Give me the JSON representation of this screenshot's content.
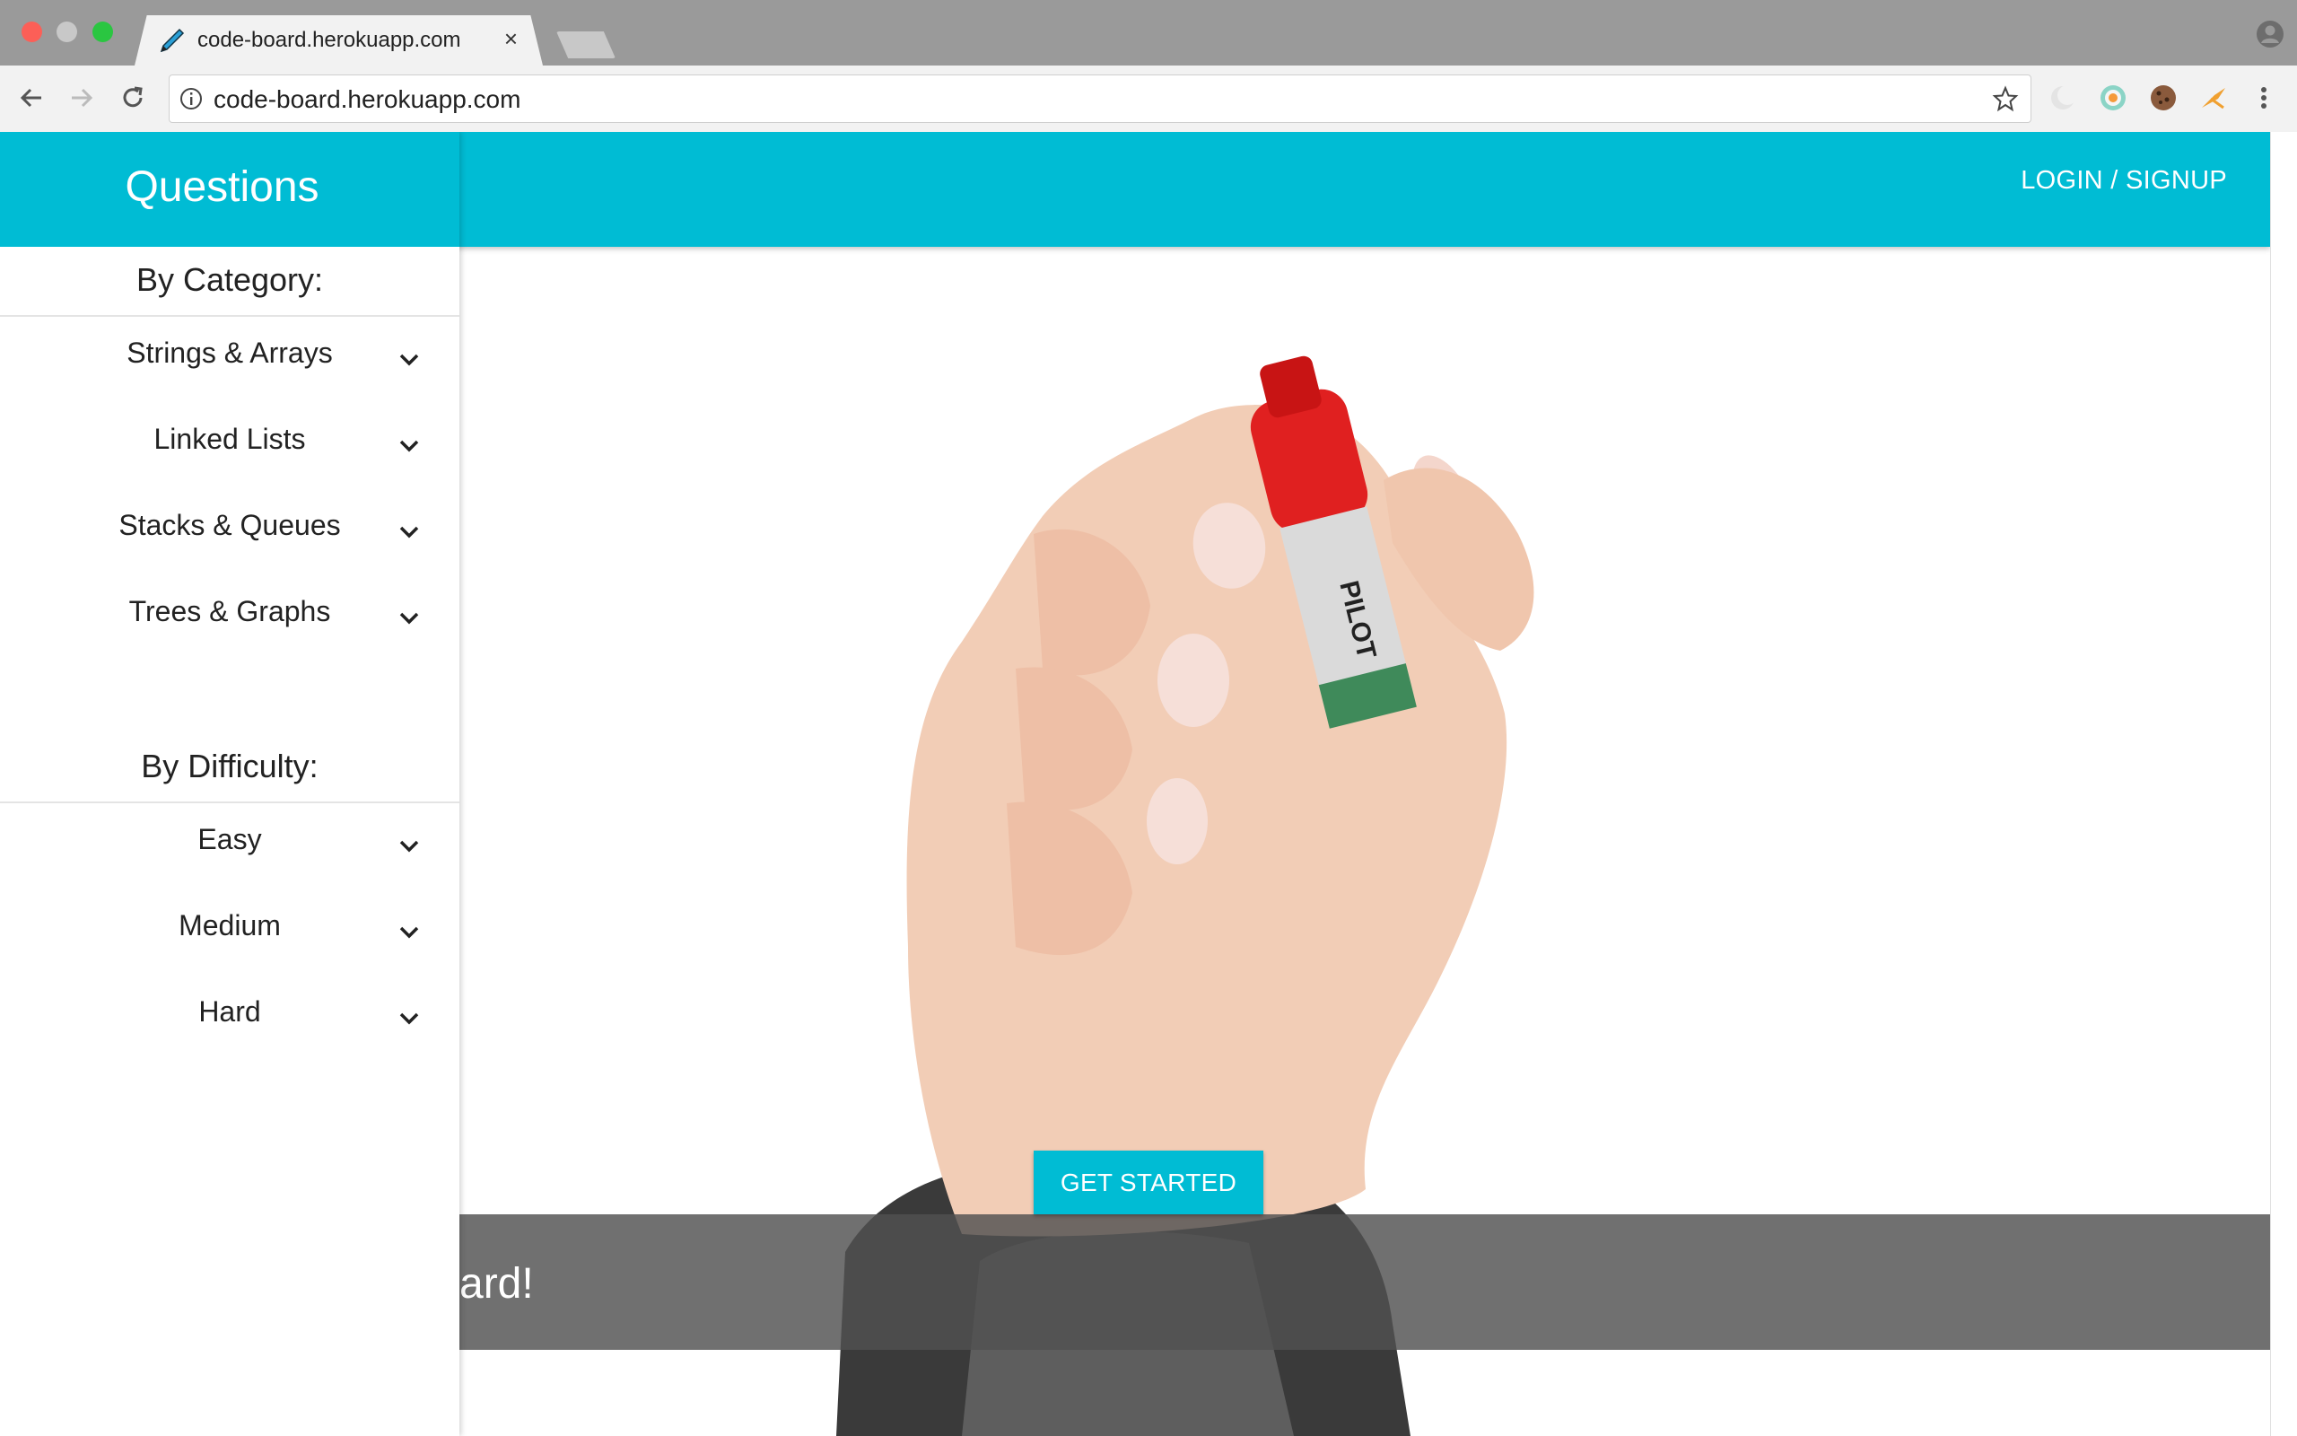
{
  "browser": {
    "tab_title": "code-board.herokuapp.com",
    "tab_close": "×",
    "url": "code-board.herokuapp.com"
  },
  "colors": {
    "accent": "#00bcd4",
    "banner": "#505050"
  },
  "sidebar": {
    "title": "Questions",
    "category_heading": "By Category:",
    "categories": [
      {
        "label": "Strings & Arrays",
        "icon": "chevron-down-icon"
      },
      {
        "label": "Linked Lists",
        "icon": "chevron-down-icon"
      },
      {
        "label": "Stacks & Queues",
        "icon": "chevron-down-icon"
      },
      {
        "label": "Trees & Graphs",
        "icon": "chevron-down-icon"
      }
    ],
    "difficulty_heading": "By Difficulty:",
    "difficulties": [
      {
        "label": "Easy",
        "icon": "chevron-down-icon"
      },
      {
        "label": "Medium",
        "icon": "chevron-down-icon"
      },
      {
        "label": "Hard",
        "icon": "chevron-down-icon"
      }
    ]
  },
  "header": {
    "login_label": "LOGIN / SIGNUP"
  },
  "hero": {
    "cta_label": "GET STARTED",
    "marker_brand": "PILOT",
    "banner_text": "ard!"
  }
}
